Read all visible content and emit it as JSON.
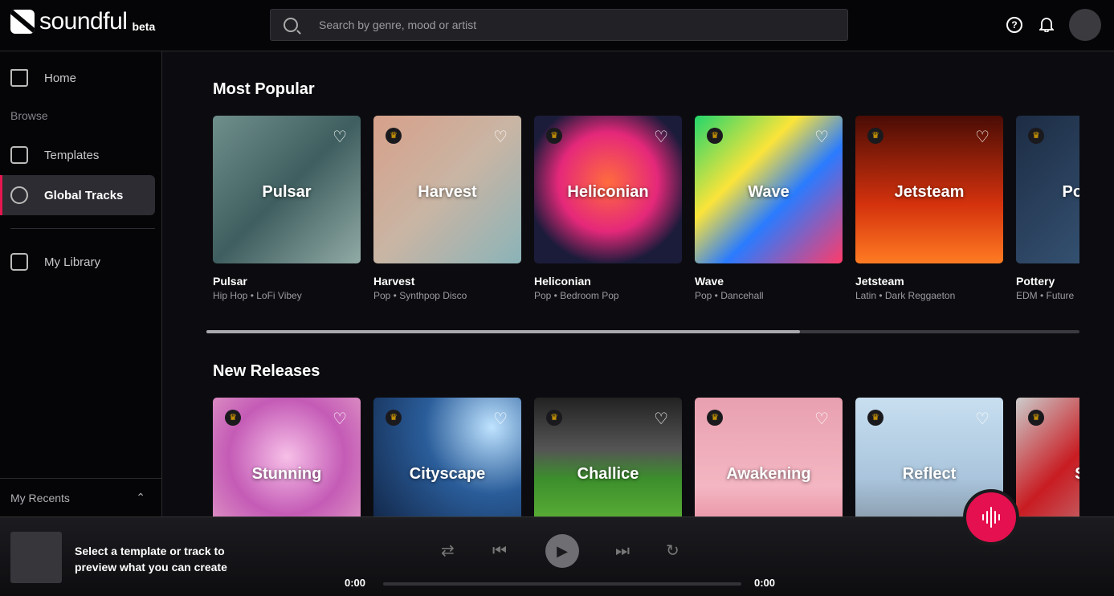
{
  "header": {
    "logo": "soundful",
    "beta": "beta",
    "search_placeholder": "Search by genre, mood or artist",
    "help_icon": "?"
  },
  "sidebar": {
    "home": "Home",
    "browse": "Browse",
    "templates": "Templates",
    "global_tracks": "Global Tracks",
    "my_library": "My Library",
    "my_recents": "My Recents"
  },
  "most_popular": {
    "title": "Most Popular",
    "scroll_position_percent": 68,
    "cards": [
      {
        "title": "Pulsar",
        "subtitle": "Hip Hop • LoFi Vibey",
        "premium": false
      },
      {
        "title": "Harvest",
        "subtitle": "Pop • Synthpop Disco",
        "premium": true
      },
      {
        "title": "Heliconian",
        "subtitle": "Pop • Bedroom Pop",
        "premium": true
      },
      {
        "title": "Wave",
        "subtitle": "Pop • Dancehall",
        "premium": true
      },
      {
        "title": "Jetsteam",
        "subtitle": "Latin • Dark Reggaeton",
        "premium": true
      },
      {
        "title": "Pottery",
        "subtitle": "EDM • Future",
        "premium": true
      }
    ]
  },
  "new_releases": {
    "title": "New Releases",
    "cards": [
      {
        "title": "Stunning",
        "premium": true
      },
      {
        "title": "Cityscape",
        "premium": true
      },
      {
        "title": "Challice",
        "premium": true
      },
      {
        "title": "Awakening",
        "premium": true
      },
      {
        "title": "Reflect",
        "premium": true
      },
      {
        "title": "Sub",
        "premium": true
      }
    ]
  },
  "player": {
    "prompt": "Select a template or track to preview what you can create",
    "current_time": "0:00",
    "total_time": "0:00"
  },
  "colors": {
    "accent": "#e5104f",
    "premium_crown": "#f5b400"
  }
}
